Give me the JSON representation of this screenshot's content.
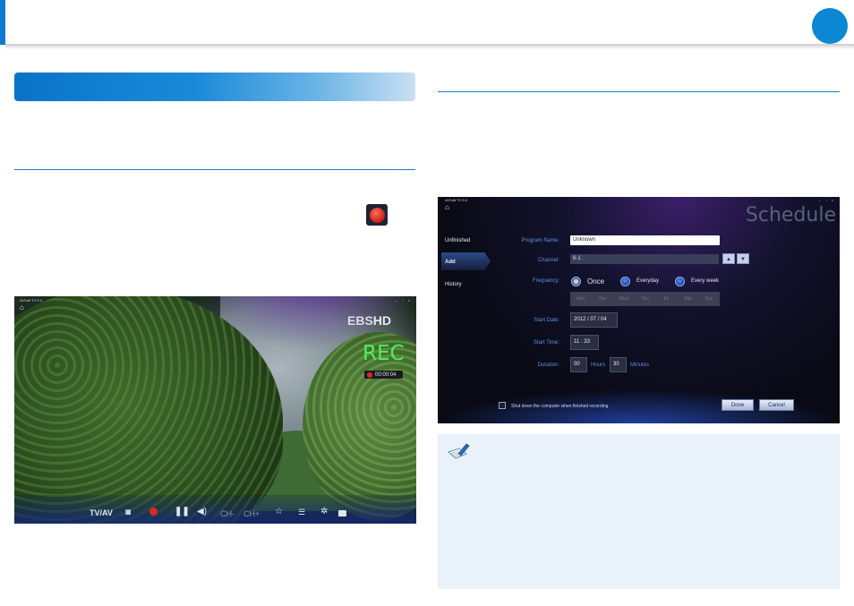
{
  "header": {
    "accent_color": "#0a7bd0",
    "page_badge_color": "#0b87d4"
  },
  "left": {
    "section_bar_color": "#1a8ad8",
    "inline_record_icon": "record-icon"
  },
  "tv_app": {
    "title": "AVSoft TV 5.0",
    "channel_logo": {
      "ebs": "EBS",
      "hd": "HD"
    },
    "rec_label": "REC",
    "rec_timer": "00:00:04",
    "controls": {
      "tvav": "TV/AV",
      "ch_down": "CH-",
      "ch_up": "CH+"
    }
  },
  "schedule": {
    "app_title": "AVSoft TV 5.0",
    "heading": "Schedule",
    "nav": {
      "unfinished": "Unfinished",
      "add": "Add",
      "history": "History"
    },
    "labels": {
      "program_name": "Program Name:",
      "channel": "Channel:",
      "frequency": "Frequency:",
      "start_date": "Start Date:",
      "start_time": "Start Time:",
      "duration": "Duration:"
    },
    "program_name_value": "Unknown",
    "channel_value": "6-1",
    "frequency_options": {
      "once": "Once",
      "everyday": "Everyday",
      "every_week": "Every week"
    },
    "days": [
      "Mon",
      "Tue",
      "Wed",
      "Thu",
      "Fri",
      "Sat",
      "Sun"
    ],
    "start_date": "2012 / 07 / 04",
    "start_time": "11 : 33",
    "duration_hours": "00",
    "hours_label": "Hours",
    "duration_minutes": "30",
    "minutes_label": "Minutes",
    "shutdown_label": "Shut down the computer when finished recording",
    "done_label": "Done",
    "cancel_label": "Cancel"
  },
  "note": {
    "icon": "note-pencil-icon"
  }
}
